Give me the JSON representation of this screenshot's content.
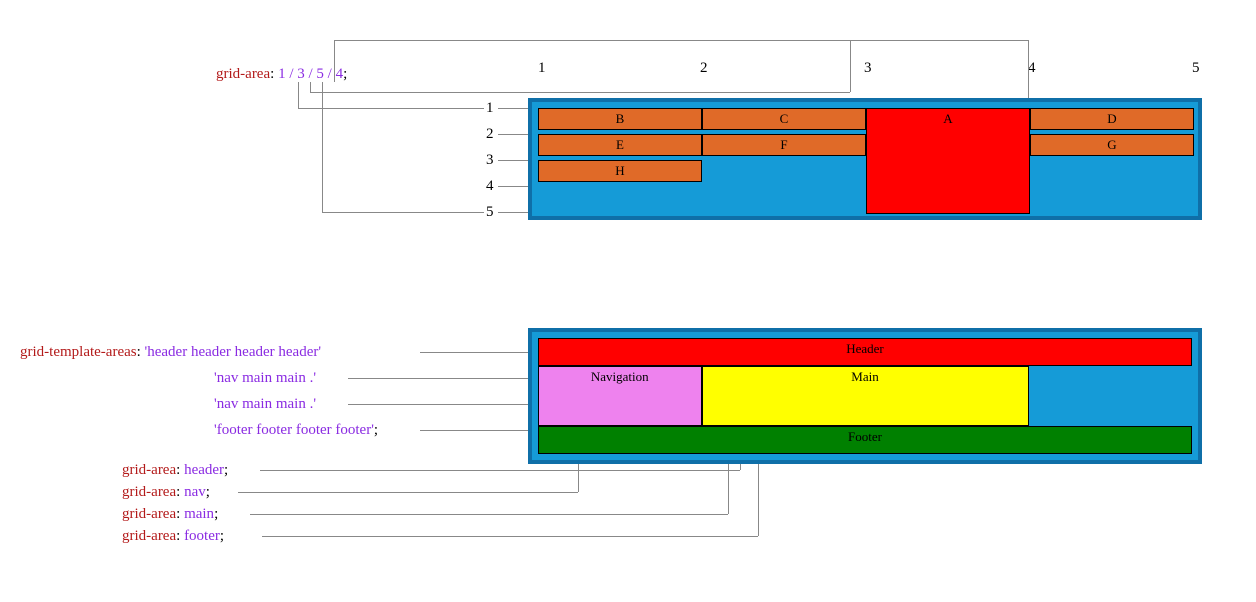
{
  "figure1": {
    "caption_prop": "grid-area",
    "caption_val": "1 / 3 / 5 / 4",
    "cols": [
      "1",
      "2",
      "3",
      "4",
      "5"
    ],
    "rows": [
      "1",
      "2",
      "3",
      "4",
      "5"
    ],
    "cells": {
      "B": "B",
      "C": "C",
      "A": "A",
      "D": "D",
      "E": "E",
      "F": "F",
      "G": "G",
      "H": "H"
    }
  },
  "figure2": {
    "template_prop": "grid-template-areas",
    "template_rows": [
      "'header header header header'",
      "'nav main main .'",
      "'nav main main .'",
      "'footer footer footer footer'"
    ],
    "area_lines": [
      {
        "prop": "grid-area",
        "val": "header"
      },
      {
        "prop": "grid-area",
        "val": "nav"
      },
      {
        "prop": "grid-area",
        "val": "main"
      },
      {
        "prop": "grid-area",
        "val": "footer"
      }
    ],
    "labels": {
      "header": "Header",
      "nav": "Navigation",
      "main": "Main",
      "footer": "Footer"
    }
  }
}
